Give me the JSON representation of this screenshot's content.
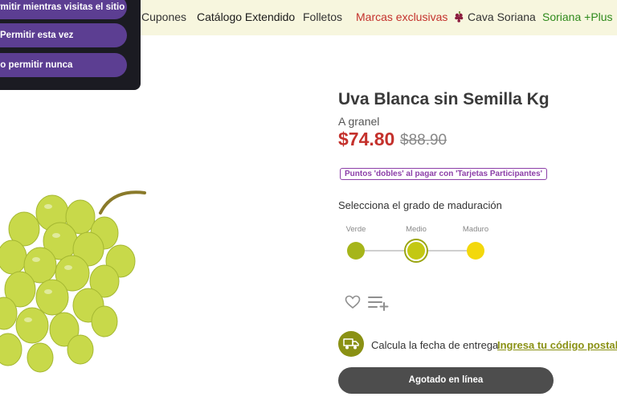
{
  "nav": {
    "items": [
      {
        "label": "Cupones",
        "style": "normal"
      },
      {
        "label": "Catálogo Extendido",
        "style": "dark"
      },
      {
        "label": "Folletos",
        "style": "normal"
      },
      {
        "label": "Marcas exclusivas",
        "style": "red"
      },
      {
        "label": "Cava Soriana",
        "style": "normal"
      },
      {
        "label": "Soriana +Plus",
        "style": "green"
      }
    ]
  },
  "permission_popup": {
    "options": [
      "Permitir mientras visitas el sitio",
      "Permitir esta vez",
      "No permitir nunca"
    ]
  },
  "product": {
    "title": "Uva Blanca sin Semilla Kg",
    "subtitle": "A granel",
    "price_current": "$74.80",
    "price_original": "$88.90",
    "promo_badge": "Puntos 'dobles' al pagar con 'Tarjetas Participantes'",
    "ripeness": {
      "heading": "Selecciona el grado de maduración",
      "options": [
        {
          "label": "Verde",
          "color": "#a6b51a"
        },
        {
          "label": "Medio",
          "color": "#c3c813"
        },
        {
          "label": "Maduro",
          "color": "#f3d80c"
        }
      ],
      "selected": "Medio"
    },
    "icons": {
      "favorite": "heart-icon",
      "add_to_list": "add-to-list-icon",
      "delivery": "truck-icon"
    },
    "delivery": {
      "text": "Calcula la fecha de entrega",
      "link": "Ingresa tu código postal"
    },
    "cta": "Agotado en línea"
  },
  "colors": {
    "nav_background": "#f7f6de",
    "price_red": "#c4312c",
    "popup_purple": "#5c3e92",
    "olive": "#8a9114",
    "promo_purple": "#8c3fa8",
    "button_dark": "#4d4d4d"
  }
}
